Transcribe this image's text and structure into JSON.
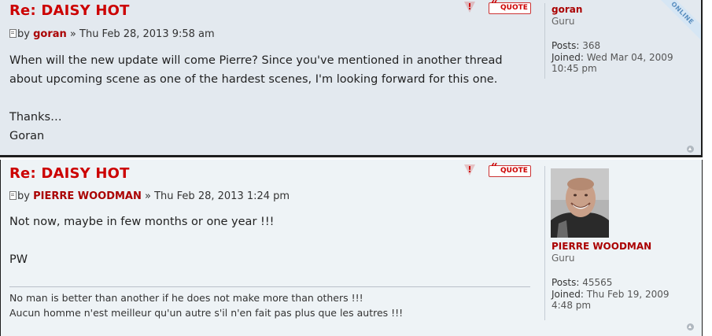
{
  "posts": [
    {
      "title": "Re: DAISY HOT",
      "by": "by",
      "author": "goran",
      "date": "» Thu Feb 28, 2013 9:58 am",
      "body": "When will the new update will come Pierre? Since you've mentioned in another thread\nabout upcoming scene as one of the hardest scenes, I'm looking forward for this one.\n\nThanks…\nGoran",
      "quote_label": "QUOTE",
      "report_label": "!",
      "profile": {
        "username": "goran",
        "rank": "Guru",
        "posts_label": "Posts:",
        "posts_value": "368",
        "joined_label": "Joined:",
        "joined_value": "Wed Mar 04, 2009 10:45 pm",
        "status": "ONLINE"
      }
    },
    {
      "title": "Re: DAISY HOT",
      "by": "by",
      "author": "PIERRE WOODMAN",
      "date": "» Thu Feb 28, 2013 1:24 pm",
      "body": "Not now, maybe in few months or one year !!!\n\nPW",
      "signature": "No man is better than another if he does not make more than others !!!\nAucun homme n'est meilleur qu'un autre s'il n'en fait pas plus que les autres !!!",
      "quote_label": "QUOTE",
      "report_label": "!",
      "profile": {
        "username": "PIERRE WOODMAN",
        "rank": "Guru",
        "posts_label": "Posts:",
        "posts_value": "45565",
        "joined_label": "Joined:",
        "joined_value": "Thu Feb 19, 2009 4:48 pm"
      }
    }
  ],
  "colors": {
    "title": "#cc0000",
    "author": "#aa0000",
    "post1_bg": "#e3e9ef",
    "post2_bg": "#eef3f6"
  }
}
